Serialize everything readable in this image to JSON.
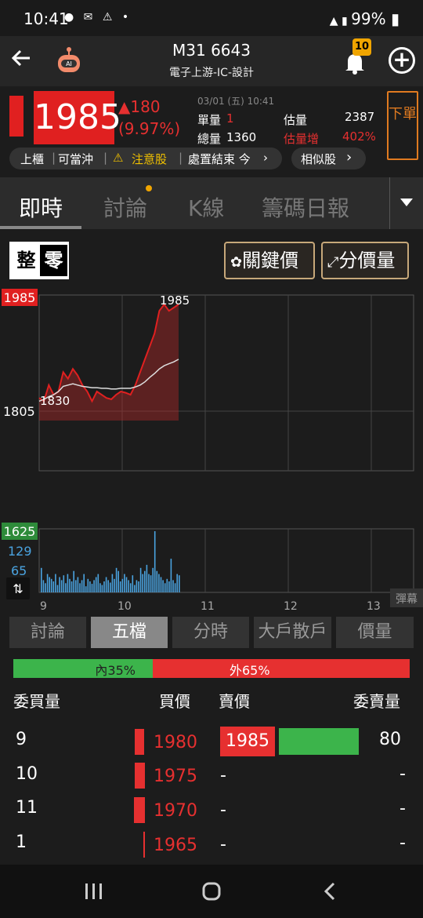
{
  "status": {
    "time": "10:41",
    "battery": "99%"
  },
  "header": {
    "title": "M31 6643",
    "subtitle": "電子上游-IC-設計",
    "bell_badge": "10"
  },
  "quote": {
    "price": "1985",
    "change": "▲180",
    "change_pct": "(9.97%)",
    "datetime": "03/01 (五) 10:41",
    "unit_vol_label": "單量",
    "unit_vol": "1",
    "total_vol_label": "總量",
    "total_vol": "1360",
    "est_label": "估量",
    "est_vol": "2387",
    "est_inc_label": "估量增",
    "est_inc": "402%",
    "sell_button": "下單"
  },
  "tags": {
    "market": "上櫃",
    "daytrade": "可當沖",
    "warning": "注意股",
    "disposal": "處置結束 今",
    "similar": "相似股"
  },
  "tabs": [
    "即時",
    "討論",
    "K線",
    "籌碼日報"
  ],
  "chart_controls": {
    "toggle_a": "整",
    "toggle_b": "零",
    "key_price": "關鍵價",
    "price_vol": "分價量",
    "danmu": "彈幕"
  },
  "chart_data": {
    "type": "line",
    "y_max_label": "1985",
    "y_min_label": "1805",
    "high_label": "1985",
    "low_label": "1830",
    "vol_max_label": "1625",
    "vol_mid_label": "129",
    "vol_low_label": "65",
    "x_ticks": [
      "9",
      "10",
      "11",
      "12",
      "13"
    ],
    "price_series": [
      1840,
      1835,
      1860,
      1845,
      1850,
      1880,
      1870,
      1885,
      1875,
      1860,
      1850,
      1835,
      1850,
      1845,
      1840,
      1838,
      1845,
      1850,
      1848,
      1845,
      1860,
      1880,
      1900,
      1920,
      1940,
      1975,
      1985,
      1975,
      1980,
      1985
    ],
    "avg_series": [
      1835,
      1838,
      1842,
      1845,
      1850,
      1858,
      1860,
      1862,
      1860,
      1858,
      1857,
      1856,
      1856,
      1855,
      1855,
      1854,
      1854,
      1855,
      1855,
      1855,
      1857,
      1860,
      1865,
      1872,
      1878,
      1885,
      1890,
      1893,
      1896,
      1900
    ],
    "volume_series": [
      40,
      20,
      15,
      30,
      25,
      22,
      18,
      30,
      12,
      25,
      20,
      28,
      15,
      30,
      22,
      18,
      35,
      20,
      25,
      15,
      20,
      30,
      10,
      22,
      18,
      14,
      20,
      25,
      30,
      15,
      12,
      18,
      25,
      20,
      16,
      30,
      22,
      40,
      35,
      18,
      22,
      30,
      25,
      20,
      15,
      28,
      12,
      20,
      18,
      40,
      30,
      35,
      45,
      30,
      28,
      40,
      100,
      35,
      30,
      25,
      20,
      15,
      22,
      18,
      55,
      20,
      15,
      30,
      28
    ]
  },
  "subtabs": [
    "討論",
    "五檔",
    "分時",
    "大戶散戶",
    "價量"
  ],
  "orderbook": {
    "inner": "內35%",
    "outer": "外65%",
    "headers": {
      "bid_vol": "委買量",
      "bid_price": "買價",
      "ask_price": "賣價",
      "ask_vol": "委賣量"
    },
    "rows": [
      {
        "bid_vol": "9",
        "bid": "1980",
        "ask": "1985",
        "ask_vol": "80"
      },
      {
        "bid_vol": "10",
        "bid": "1975",
        "ask": "-",
        "ask_vol": "-"
      },
      {
        "bid_vol": "11",
        "bid": "1970",
        "ask": "-",
        "ask_vol": "-"
      },
      {
        "bid_vol": "1",
        "bid": "1965",
        "ask": "-",
        "ask_vol": "-"
      }
    ]
  }
}
